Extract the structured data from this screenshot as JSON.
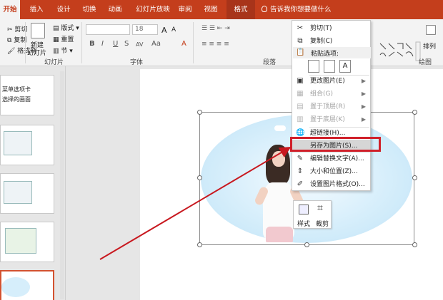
{
  "tabs": [
    {
      "label": "开始",
      "active": true
    },
    {
      "label": "插入"
    },
    {
      "label": "设计"
    },
    {
      "label": "切换"
    },
    {
      "label": "动画"
    },
    {
      "label": "幻灯片放映"
    },
    {
      "label": "审阅"
    },
    {
      "label": "视图"
    },
    {
      "label": "格式",
      "context": true
    }
  ],
  "tell_me": "告诉我你想要做什么",
  "ribbon": {
    "clipboard": {
      "cut": "剪切",
      "copy": "复制",
      "format_painter": "格式刷"
    },
    "slides": {
      "new_slide": "新建",
      "new_slide_line2": "幻灯片",
      "layout": "版式",
      "reset": "重置",
      "section": "节",
      "group_label": "幻灯片"
    },
    "font": {
      "name": "",
      "size": "18",
      "grow": "A",
      "shrink": "A",
      "group_label": "字体",
      "bold": "B",
      "italic": "I",
      "underline": "U",
      "strike": "S",
      "spacing": "AV",
      "case": "Aa",
      "color": "A"
    },
    "paragraph": {
      "group_label": "段落"
    },
    "drawing": {
      "arrange": "排列",
      "group_label": "绘图"
    }
  },
  "thumbs": [
    {
      "line1": "菜单选项卡",
      "line2": "选择的画面"
    },
    {},
    {},
    {},
    {
      "selected": true
    }
  ],
  "context_menu": {
    "items": [
      {
        "icon": "✂",
        "label": "剪切(T)",
        "icon_name": "scissors-icon"
      },
      {
        "icon": "⧉",
        "label": "复制(C)",
        "icon_name": "copy-icon"
      },
      {
        "header": true,
        "label": "粘贴选项:",
        "icon_name": "paste-icon"
      },
      {
        "icon": "▣",
        "label": "更改图片(E)",
        "arrow": true,
        "icon_name": "change-picture-icon"
      },
      {
        "icon": "▦",
        "label": "组合(G)",
        "arrow": true,
        "disabled": true,
        "icon_name": "group-icon"
      },
      {
        "icon": "▤",
        "label": "置于顶层(R)",
        "arrow": true,
        "disabled": true,
        "icon_name": "bring-front-icon"
      },
      {
        "icon": "▥",
        "label": "置于底层(K)",
        "arrow": true,
        "disabled": true,
        "icon_name": "send-back-icon"
      },
      {
        "icon": "🌐",
        "label": "超链接(H)...",
        "icon_name": "hyperlink-icon"
      },
      {
        "icon": "",
        "label": "另存为图片(S)...",
        "highlight": true,
        "icon_name": "save-as-picture-icon"
      },
      {
        "icon": "✎",
        "label": "编辑替换文字(A)...",
        "icon_name": "alt-text-icon"
      },
      {
        "icon": "⇕",
        "label": "大小和位置(Z)...",
        "icon_name": "size-position-icon"
      },
      {
        "icon": "✐",
        "label": "设置图片格式(O)...",
        "icon_name": "format-picture-icon"
      }
    ]
  },
  "mini_toolbar": {
    "style": "样式",
    "crop": "裁剪"
  },
  "colors": {
    "accent": "#c43e1c",
    "highlight_border": "#d0202a",
    "arrow": "#c8181f"
  }
}
